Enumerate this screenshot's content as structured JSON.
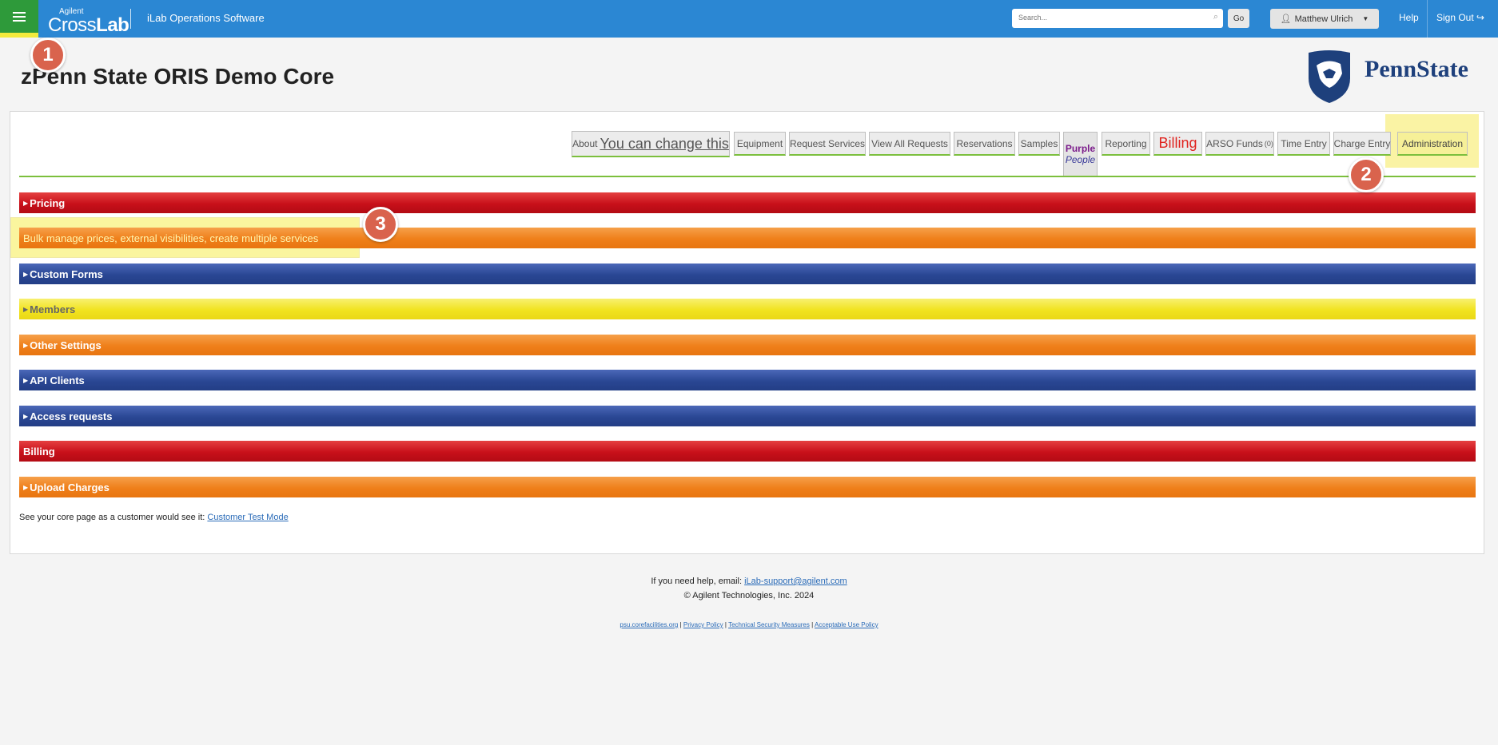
{
  "header": {
    "logo_small": "Agilent",
    "logo_big_regular": "Cross",
    "logo_big_bold": "Lab",
    "app_name": "iLab Operations Software",
    "search_placeholder": "Search...",
    "go_label": "Go",
    "user_name": "Matthew Ulrich",
    "help_label": "Help",
    "signout_label": "Sign Out"
  },
  "callouts": [
    "1",
    "2",
    "3"
  ],
  "page_title": "zPenn State ORIS Demo Core",
  "brand_logo_text": "PennState",
  "tabs": {
    "about_small": "About",
    "about_big": "You can change this",
    "equipment": "Equipment",
    "request_services": "Request Services",
    "view_all_requests": "View All Requests",
    "reservations": "Reservations",
    "samples": "Samples",
    "purple_line1": "Purple",
    "purple_line2": "People",
    "reporting": "Reporting",
    "billing": "Billing",
    "arso_funds": "ARSO Funds",
    "arso_count": "(0)",
    "time_entry": "Time Entry",
    "charge_entry": "Charge Entry",
    "administration": "Administration"
  },
  "sections": {
    "pricing": "Pricing",
    "bulk": "Bulk manage prices, external visibilities, create multiple services",
    "custom_forms": "Custom Forms",
    "members": "Members",
    "other_settings": "Other Settings",
    "api_clients": "API Clients",
    "access_requests": "Access requests",
    "billing": "Billing",
    "upload_charges": "Upload Charges"
  },
  "test_mode": {
    "text": "See your core page as a customer would see it: ",
    "link": "Customer Test Mode"
  },
  "footer": {
    "help_text": "If you need help, email: ",
    "help_email": "iLab-support@agilent.com",
    "copyright": "© Agilent Technologies, Inc. 2024",
    "links": [
      "psu.corefacilities.org",
      "Privacy Policy",
      "Technical Security Measures",
      "Acceptable Use Policy"
    ],
    "link_separator": "|"
  },
  "colors": {
    "topbar": "#2b87d3",
    "red_bar": "#c8101a",
    "orange_bar": "#ef7f1a",
    "blue_bar": "#2a4794",
    "yellow_bar": "#f1e31f",
    "highlight": "#f5ea2a",
    "callout": "#d9634d"
  }
}
